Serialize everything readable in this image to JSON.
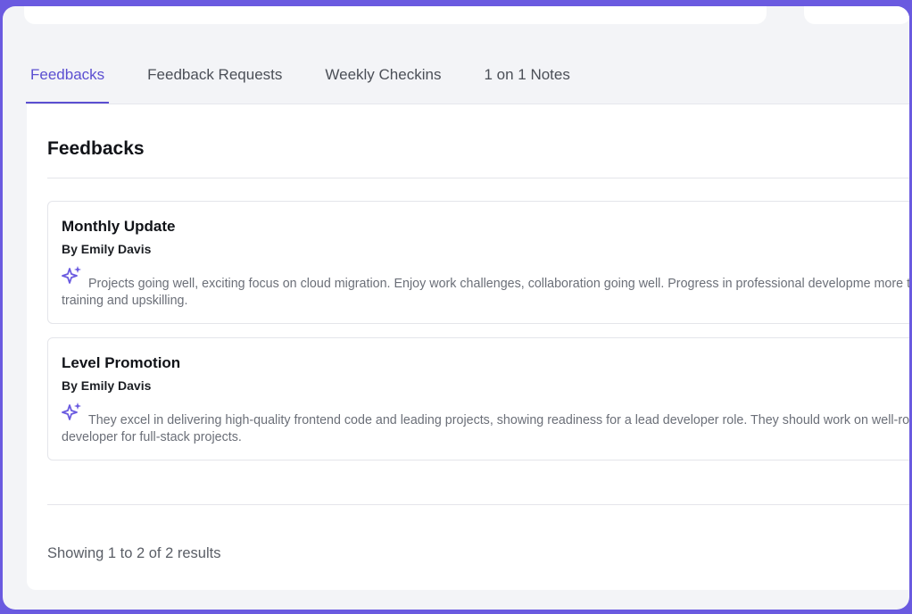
{
  "tabs": [
    {
      "label": "Feedbacks",
      "active": true
    },
    {
      "label": "Feedback Requests",
      "active": false
    },
    {
      "label": "Weekly Checkins",
      "active": false
    },
    {
      "label": "1 on 1 Notes",
      "active": false
    }
  ],
  "panel": {
    "title": "Feedbacks",
    "cards": [
      {
        "title": "Monthly Update",
        "author": "By Emily Davis",
        "icon": "sparkle-icon",
        "text": "Projects going well, exciting focus on cloud migration. Enjoy work challenges, collaboration going well. Progress in professional developme more team training and upskilling."
      },
      {
        "title": "Level Promotion",
        "author": "By Emily Davis",
        "icon": "sparkle-icon",
        "text": "They excel in delivering high-quality frontend code and leading projects, showing readiness for a lead developer role. They should work on well-rounded developer for full-stack projects."
      }
    ],
    "results_text": "Showing 1 to 2 of 2 results"
  },
  "colors": {
    "accent": "#5b4fd1",
    "frame": "#6a5ae0",
    "sparkle": "#6a5ae0"
  }
}
